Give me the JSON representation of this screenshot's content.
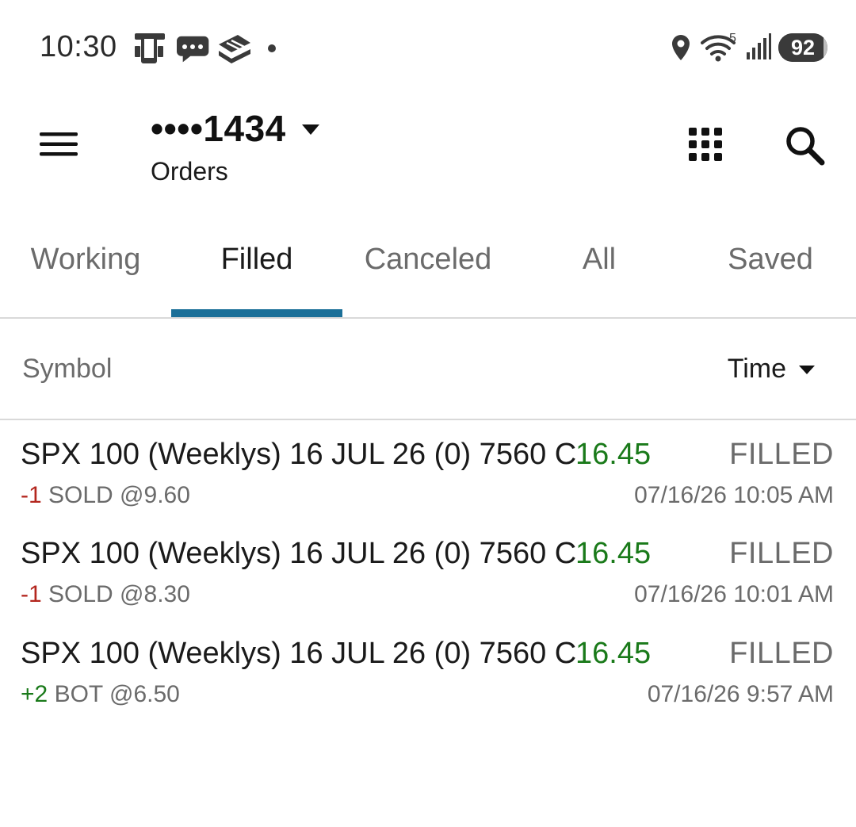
{
  "status_bar": {
    "time": "10:30",
    "notification_icons": [
      "phone-cast-icon",
      "chat-bubble-icon",
      "stacked-cards-icon"
    ],
    "wifi_badge": "5",
    "battery_level": "92",
    "battery_fraction": 0.92
  },
  "header": {
    "account_number": "••••1434",
    "subtitle": "Orders"
  },
  "tabs": [
    {
      "label": "Working"
    },
    {
      "label": "Filled"
    },
    {
      "label": "Canceled"
    },
    {
      "label": "All"
    },
    {
      "label": "Saved"
    }
  ],
  "active_tab": "Filled",
  "columns": {
    "symbol": "Symbol",
    "sort": "Time"
  },
  "orders": [
    {
      "symbol": "SPX 100 (Weeklys) 16 JUL 26 (0) 7560 C",
      "price": "16.45",
      "status": "FILLED",
      "qty": "-1",
      "action": "SOLD @9.60",
      "time": "07/16/26 10:05 AM"
    },
    {
      "symbol": "SPX 100 (Weeklys) 16 JUL 26 (0) 7560 C",
      "price": "16.45",
      "status": "FILLED",
      "qty": "-1",
      "action": "SOLD @8.30",
      "time": "07/16/26 10:01 AM"
    },
    {
      "symbol": "SPX 100 (Weeklys) 16 JUL 26 (0) 7560 C",
      "price": "16.45",
      "status": "FILLED",
      "qty": "+2",
      "action": "BOT @6.50",
      "time": "07/16/26 9:57 AM"
    }
  ],
  "colors": {
    "accent": "#1b6f98",
    "price_positive": "#1a7a1a",
    "qty_negative": "#b3261e",
    "qty_positive": "#1a7a1a"
  }
}
